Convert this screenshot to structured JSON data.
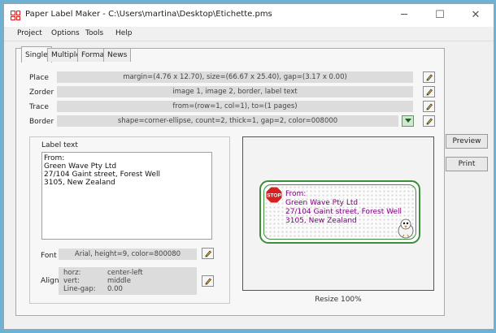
{
  "window": {
    "title": "Paper Label Maker - C:\\Users\\martina\\Desktop\\Etichette.pms",
    "minimize_glyph": "─",
    "maximize_glyph": "☐",
    "close_glyph": "✕"
  },
  "menu": {
    "items": [
      "Project",
      "Options",
      "Tools",
      "Help"
    ]
  },
  "tabs": [
    "Single",
    "Multiple",
    "Format",
    "News"
  ],
  "active_tab": "Single",
  "settings": {
    "place": {
      "label": "Place",
      "value": "margin=(4.76 x 12.70), size=(66.67 x 25.40), gap=(3.17 x 0.00)"
    },
    "zorder": {
      "label": "Zorder",
      "value": "image 1, image 2, border, label text"
    },
    "trace": {
      "label": "Trace",
      "value": "from=(row=1, col=1), to=(1 pages)"
    },
    "border": {
      "label": "Border",
      "value": "shape=corner-ellipse, count=2, thick=1, gap=2, color=008000"
    }
  },
  "label_text": {
    "heading": "Label text",
    "lines": [
      "From:",
      "Green Wave Pty Ltd",
      "27/104 Gaint street, Forest Well",
      "3105, New Zealand"
    ]
  },
  "font": {
    "label": "Font",
    "value": "Arial, height=9, color=800080"
  },
  "align": {
    "label": "Align",
    "horz_key": "horz:",
    "horz_value": "center-left",
    "vert_key": "vert:",
    "vert_value": "middle",
    "gap_key": "Line-gap:",
    "gap_value": "0.00"
  },
  "preview": {
    "stop_text": "STOP",
    "resize_text": "Resize 100%"
  },
  "buttons": {
    "preview": "Preview",
    "print": "Print"
  },
  "colors": {
    "label_text": "#800080",
    "border": "#008000",
    "background": "#6fb1d2"
  },
  "icons": [
    "app-icon",
    "pencil-icon",
    "dropdown-icon",
    "stop-sign-icon",
    "bird-icon"
  ]
}
